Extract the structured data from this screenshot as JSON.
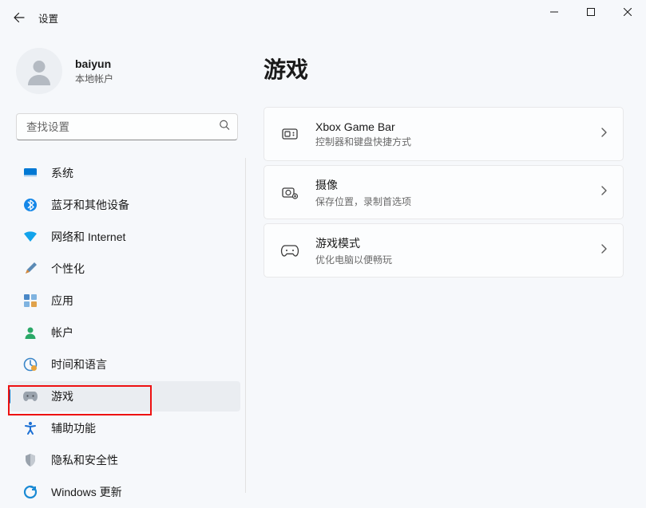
{
  "titlebar": {
    "title": "设置"
  },
  "profile": {
    "name": "baiyun",
    "sub": "本地帐户"
  },
  "search": {
    "placeholder": "查找设置"
  },
  "sidebar": {
    "items": [
      {
        "label": "系统"
      },
      {
        "label": "蓝牙和其他设备"
      },
      {
        "label": "网络和 Internet"
      },
      {
        "label": "个性化"
      },
      {
        "label": "应用"
      },
      {
        "label": "帐户"
      },
      {
        "label": "时间和语言"
      },
      {
        "label": "游戏"
      },
      {
        "label": "辅助功能"
      },
      {
        "label": "隐私和安全性"
      },
      {
        "label": "Windows 更新"
      }
    ]
  },
  "main": {
    "page_title": "游戏",
    "cards": [
      {
        "title": "Xbox Game Bar",
        "sub": "控制器和键盘快捷方式"
      },
      {
        "title": "摄像",
        "sub": "保存位置，录制首选项"
      },
      {
        "title": "游戏模式",
        "sub": "优化电脑以便畅玩"
      }
    ]
  }
}
